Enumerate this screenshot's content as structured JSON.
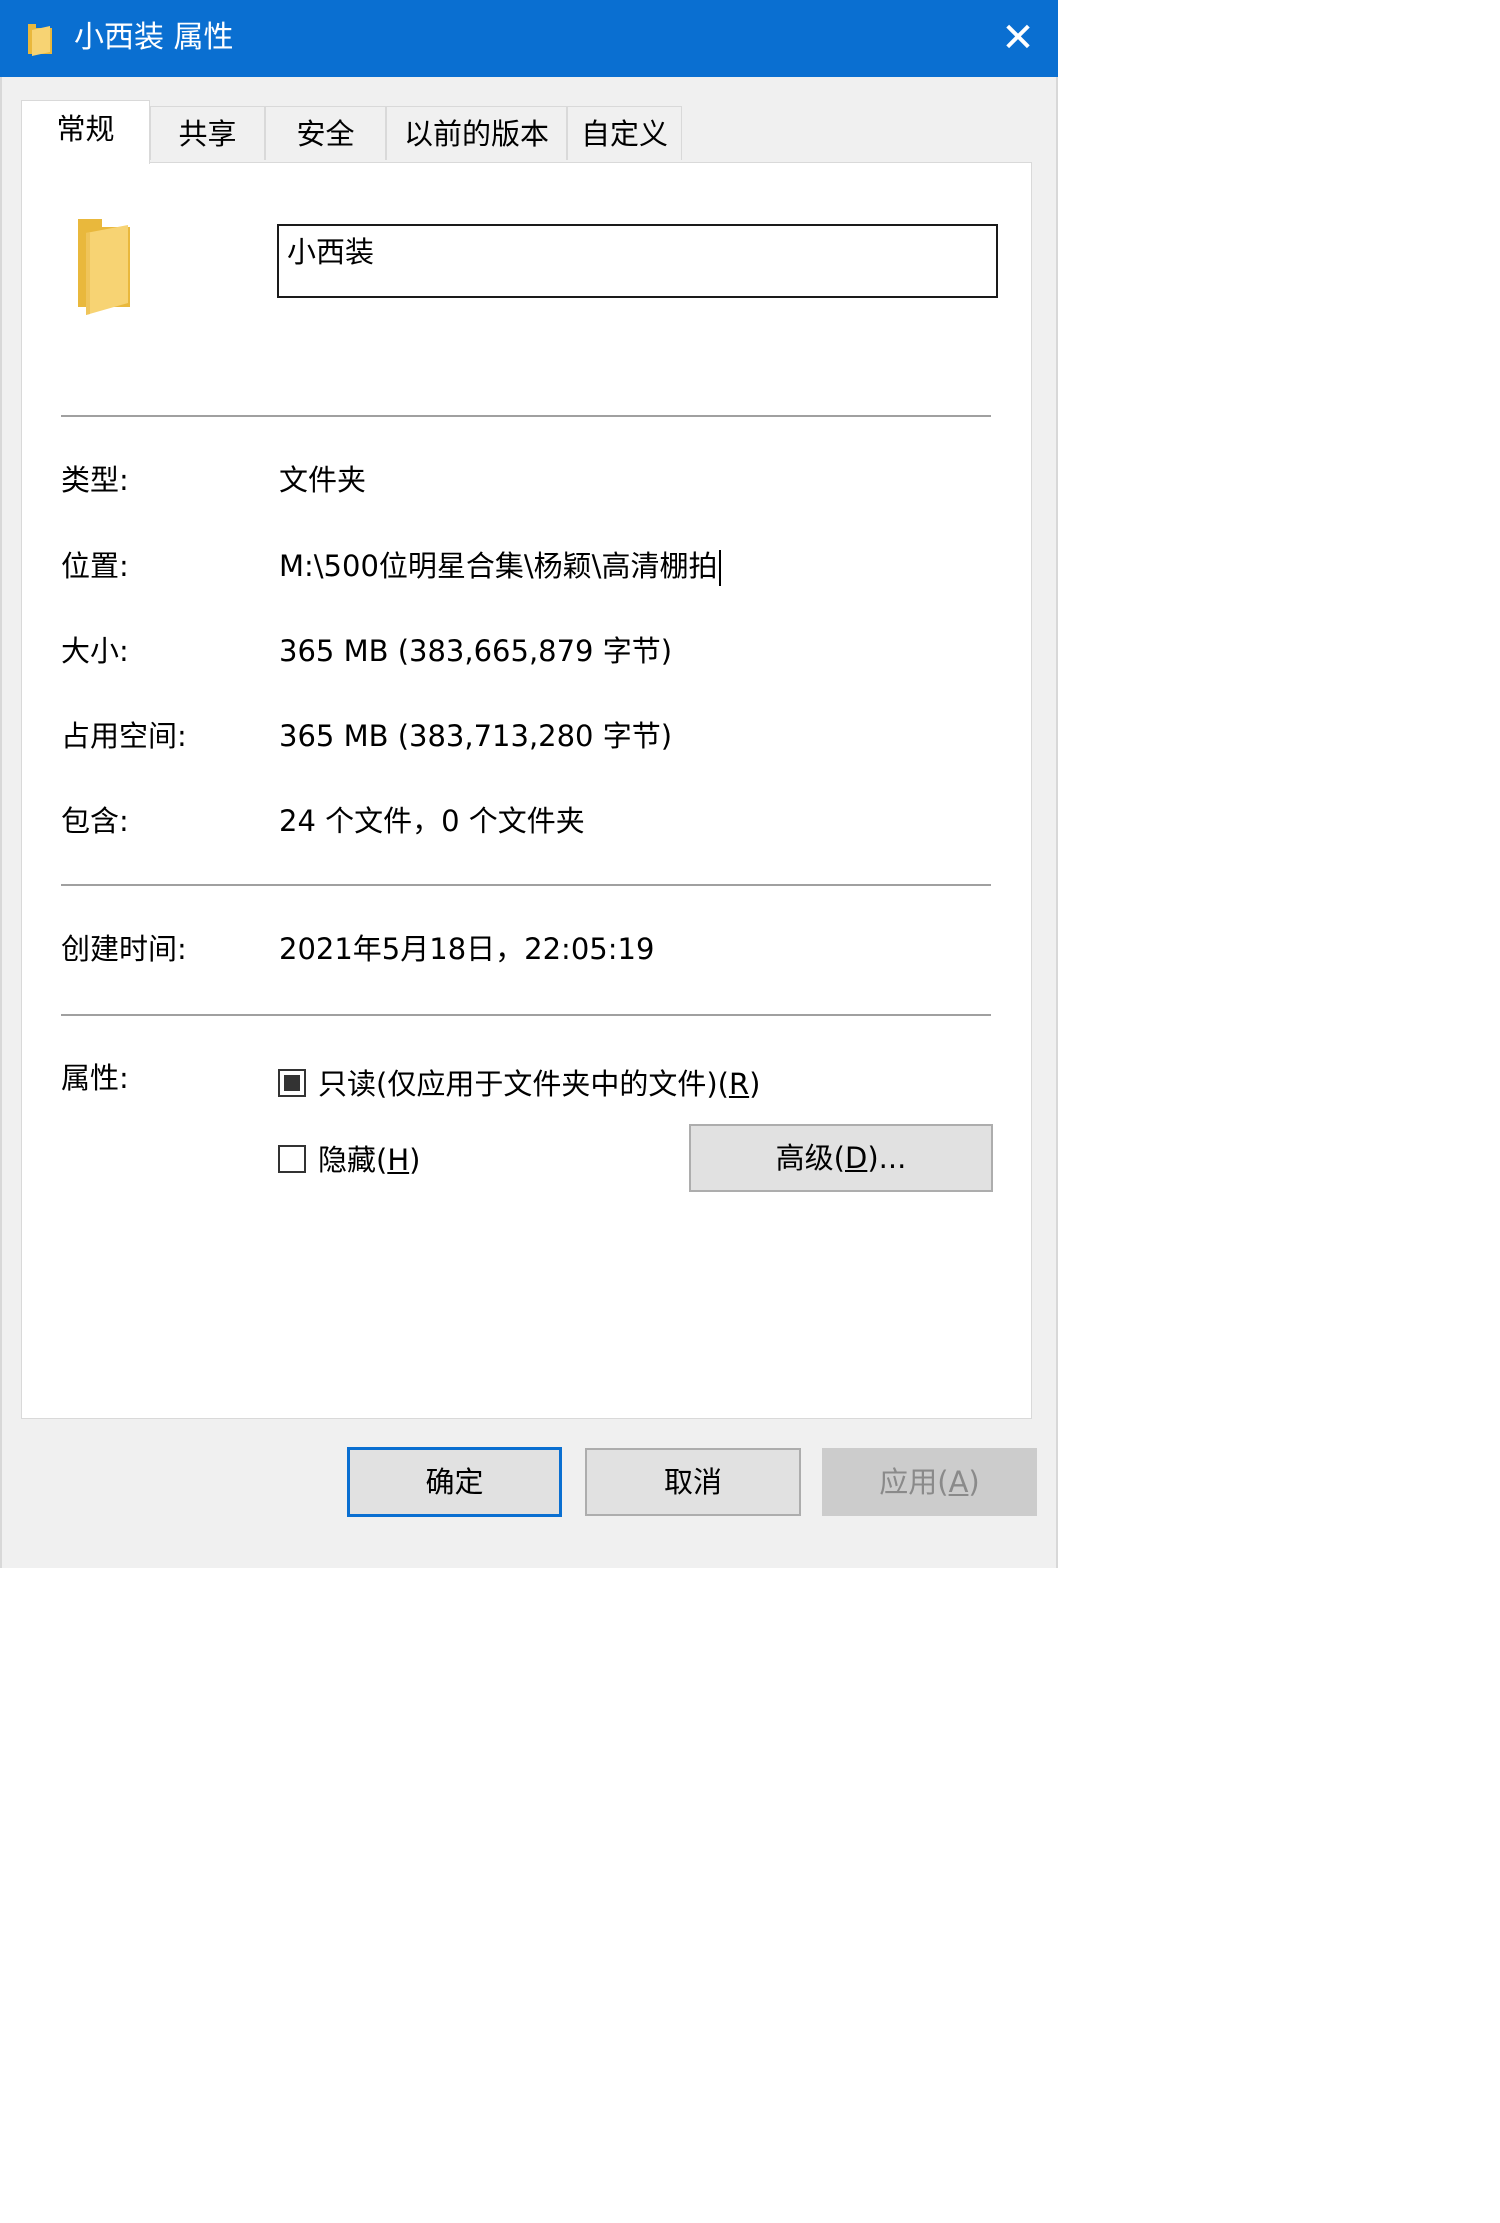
{
  "window": {
    "title": "小西装 属性",
    "title_icon": "folder-icon",
    "close_glyph": "✕"
  },
  "tabs": [
    {
      "label": "常规",
      "active": true
    },
    {
      "label": "共享",
      "active": false
    },
    {
      "label": "安全",
      "active": false
    },
    {
      "label": "以前的版本",
      "active": false
    },
    {
      "label": "自定义",
      "active": false
    }
  ],
  "general": {
    "folder_icon": "folder-icon",
    "name": "小西装",
    "type_label": "类型:",
    "type_value": "文件夹",
    "location_label": "位置:",
    "location_value": "M:\\500位明星合集\\杨颖\\高清棚拍",
    "size_label": "大小:",
    "size_value": "365 MB (383,665,879 字节)",
    "disk_size_label": "占用空间:",
    "disk_size_value": "365 MB (383,713,280 字节)",
    "contains_label": "包含:",
    "contains_value": "24 个文件，0 个文件夹",
    "created_label": "创建时间:",
    "created_value": "2021年5月18日，22:05:19",
    "attributes_label": "属性:",
    "readonly": {
      "label_before": "只读(仅应用于文件夹中的文件)(",
      "accel": "R",
      "label_after": ")",
      "state": "indeterminate"
    },
    "hidden": {
      "label_before": "隐藏(",
      "accel": "H",
      "label_after": ")",
      "checked": false
    },
    "advanced_button": {
      "label_before": "高级(",
      "accel": "D",
      "label_after": ")..."
    }
  },
  "footer": {
    "ok_label": "确定",
    "cancel_label": "取消",
    "apply": {
      "label_before": "应用(",
      "accel": "A",
      "label_after": ")"
    }
  },
  "colors": {
    "titlebar": "#0a6fd1",
    "dialog_background": "#f0f0f0",
    "button_face": "#e1e1e1",
    "folder_yellow": "#f7d373"
  }
}
